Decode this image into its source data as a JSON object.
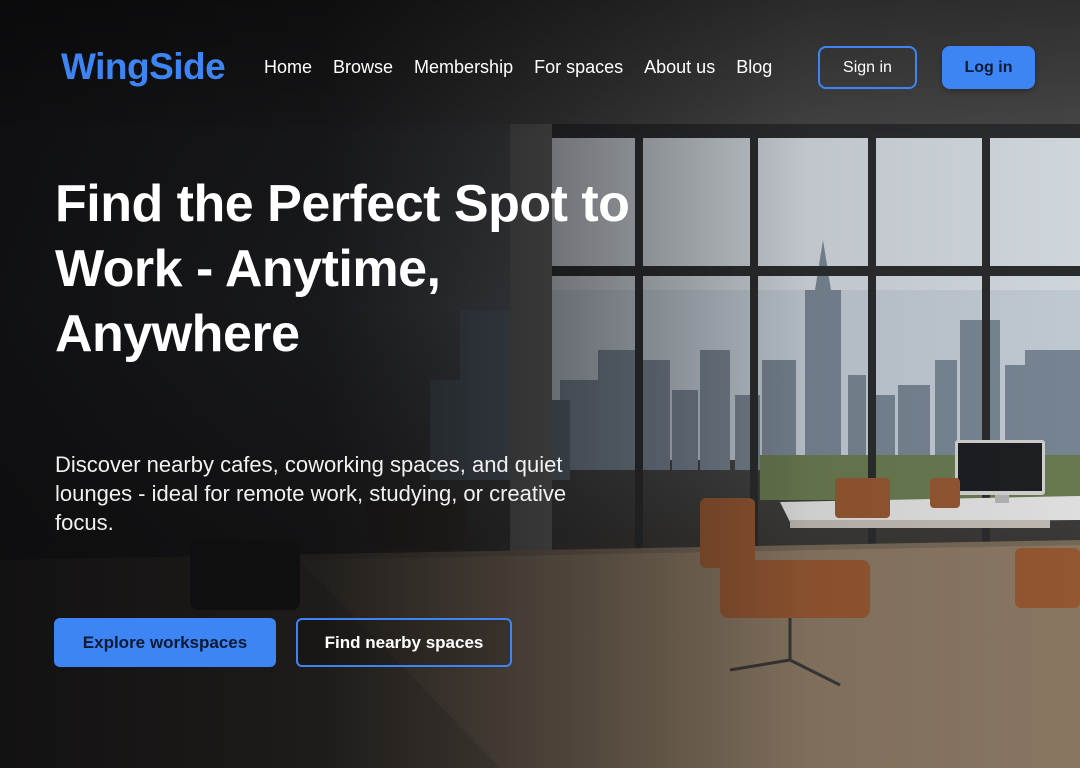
{
  "brand": {
    "name": "WingSide",
    "accent": "#3d84f5"
  },
  "nav": {
    "items": [
      {
        "label": "Home"
      },
      {
        "label": "Browse"
      },
      {
        "label": "Membership"
      },
      {
        "label": "For spaces"
      },
      {
        "label": "About us"
      },
      {
        "label": "Blog"
      }
    ],
    "sign_in": "Sign in",
    "log_in": "Log in"
  },
  "hero": {
    "headline": "Find the Perfect Spot to Work - Anytime, Anywhere",
    "subtitle": "Discover nearby cafes, coworking spaces, and quiet lounges - ideal for remote work, studying, or creative focus.",
    "primary_cta": "Explore workspaces",
    "secondary_cta": "Find nearby spaces",
    "background": "office-with-city-skyline-photo"
  }
}
